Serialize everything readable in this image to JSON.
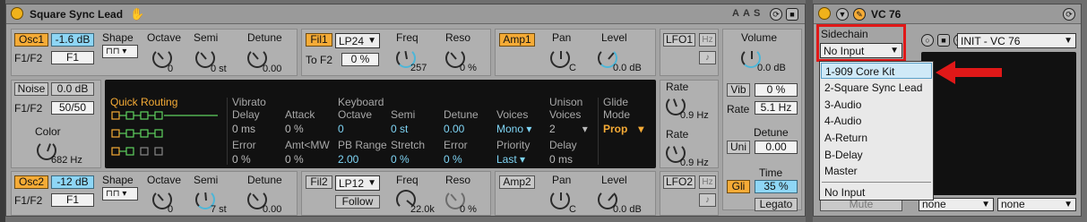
{
  "synth": {
    "title": "Square Sync Lead",
    "title_icons": [
      "A",
      "A",
      "S"
    ],
    "osc1": {
      "label": "Osc1",
      "level": "-1.6 dB",
      "f1f2": "F1/F2",
      "f1": "F1",
      "shape_label": "Shape",
      "octave_label": "Octave",
      "octave_val": "0",
      "semi_label": "Semi",
      "semi_val": "0 st",
      "detune_label": "Detune",
      "detune_val": "0.00"
    },
    "fil1": {
      "label": "Fil1",
      "type": "LP24",
      "to_f2": "To F2",
      "to_f2_val": "0 %",
      "freq_label": "Freq",
      "freq_val": "257",
      "reso_label": "Reso",
      "reso_val": "0 %"
    },
    "amp1": {
      "label": "Amp1",
      "pan_label": "Pan",
      "pan_val": "C",
      "level_label": "Level",
      "level_val": "0.0 dB"
    },
    "noise": {
      "label": "Noise",
      "level": "0.0 dB",
      "f1f2": "F1/F2",
      "f1f2_val": "50/50",
      "color_label": "Color",
      "color_val": "682 Hz"
    },
    "osc2": {
      "label": "Osc2",
      "level": "-12 dB",
      "f1f2": "F1/F2",
      "f1": "F1",
      "shape_label": "Shape",
      "octave_label": "Octave",
      "octave_val": "0",
      "semi_label": "Semi",
      "semi_val": "7 st",
      "detune_label": "Detune",
      "detune_val": "0.00"
    },
    "fil2": {
      "label": "Fil2",
      "type": "LP12",
      "follow": "Follow",
      "freq_label": "Freq",
      "freq_val": "22.0k",
      "reso_label": "Reso",
      "reso_val": "0 %"
    },
    "amp2": {
      "label": "Amp2",
      "pan_label": "Pan",
      "pan_val": "C",
      "level_label": "Level",
      "level_val": "0.0 dB"
    },
    "center": {
      "quick_routing": "Quick Routing",
      "vibrato": "Vibrato",
      "delay": "Delay",
      "delay_val": "0 ms",
      "error": "Error",
      "error_val": "0 %",
      "attack": "Attack",
      "attack_val": "0 %",
      "amt_mw": "Amt<MW",
      "amt_mw_val": "0 %",
      "keyboard": "Keyboard",
      "octave": "Octave",
      "octave_val": "0",
      "pb_range": "PB Range",
      "pb_range_val": "2.00",
      "semi": "Semi",
      "semi_val": "0 st",
      "stretch": "Stretch",
      "stretch_val": "0 %",
      "detune": "Detune",
      "detune_val": "0.00",
      "error2": "Error",
      "error2_val": "0 %",
      "voices": "Voices",
      "voices_val": "Mono",
      "priority": "Priority",
      "priority_val": "Last",
      "unison": "Unison",
      "unison_voices": "Voices",
      "unison_val": "2",
      "unison_delay": "Delay",
      "unison_delay_val": "0 ms",
      "glide": "Glide",
      "glide_mode": "Mode",
      "glide_val": "Prop"
    },
    "lfo1": {
      "label": "LFO1",
      "hz": "Hz",
      "rate": "Rate",
      "rate_val": "0.9 Hz",
      "note_icon": "♪"
    },
    "lfo2": {
      "label": "LFO2",
      "hz": "Hz",
      "rate": "Rate",
      "rate_val": "0.9 Hz",
      "note_icon": "♪"
    },
    "right": {
      "volume": "Volume",
      "volume_val": "0.0 dB",
      "vib": "Vib",
      "vib_val": "0 %",
      "rate": "Rate",
      "rate_val": "5.1 Hz",
      "detune": "Detune",
      "uni": "Uni",
      "uni_val": "0.00",
      "time": "Time",
      "gli": "Gli",
      "gli_val": "35 %",
      "legato": "Legato"
    }
  },
  "vocoder": {
    "title": "VC 76",
    "sidechain_label": "Sidechain",
    "sidechain_value": "No Input",
    "preset": "INIT - VC 76",
    "mute": "Mute",
    "bottom_select1": "none",
    "bottom_select2": "none",
    "menu_items": [
      "1-909 Core Kit",
      "2-Square Sync Lead",
      "3-Audio",
      "4-Audio",
      "A-Return",
      "B-Delay",
      "Master",
      "No Input"
    ],
    "highlighted_index": 0
  },
  "colors": {
    "accent_orange": "#f5ab36",
    "accent_blue": "#8ed6f5",
    "annotation_red": "#e01818",
    "menu_highlight": "#cfe9f7"
  }
}
